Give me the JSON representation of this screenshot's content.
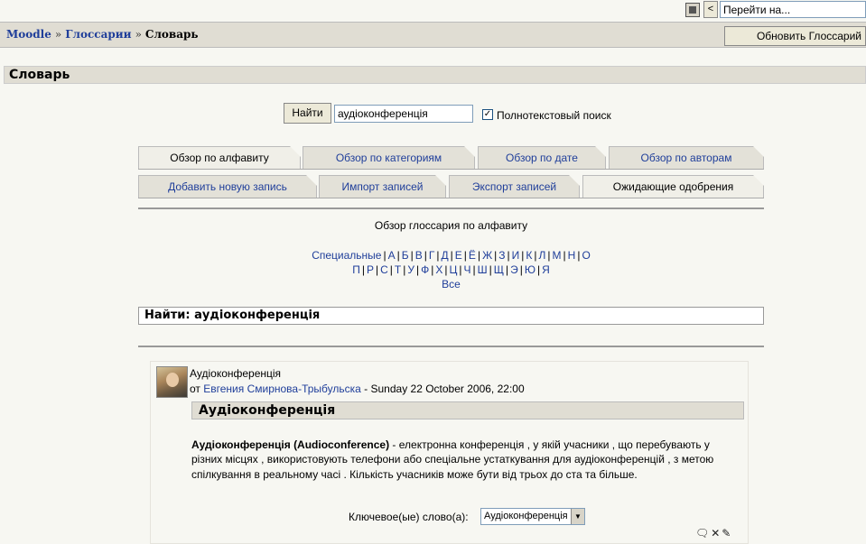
{
  "topbar": {
    "prev_label": "<",
    "jump_placeholder": "Перейти на..."
  },
  "navbar": {
    "breadcrumb": [
      "Moodle",
      "Глоссарии",
      "Словарь"
    ],
    "separator": "»",
    "update_button": "Обновить Глоссарий"
  },
  "heading": "Словарь",
  "search": {
    "button": "Найти",
    "value": "аудіоконференція",
    "fulltext_checked": true,
    "fulltext_label": "Полнотекстовый поиск"
  },
  "tabs_row1": [
    {
      "label": "Обзор по алфавиту",
      "active": true
    },
    {
      "label": "Обзор по категориям",
      "active": false
    },
    {
      "label": "Обзор по дате",
      "active": false
    },
    {
      "label": "Обзор по авторам",
      "active": false
    }
  ],
  "tabs_row2": [
    {
      "label": "Добавить новую запись",
      "active": false
    },
    {
      "label": "Импорт записей",
      "active": false
    },
    {
      "label": "Экспорт записей",
      "active": false
    },
    {
      "label": "Ожидающие одобрения",
      "active": true
    }
  ],
  "browse": {
    "title": "Обзор глоссария по алфавиту",
    "line1": [
      "Специальные",
      "А",
      "Б",
      "В",
      "Г",
      "Д",
      "Е",
      "Ё",
      "Ж",
      "З",
      "И",
      "К",
      "Л",
      "М",
      "Н",
      "О"
    ],
    "line2": [
      "П",
      "Р",
      "С",
      "Т",
      "У",
      "Ф",
      "Х",
      "Ц",
      "Ч",
      "Ш",
      "Щ",
      "Э",
      "Ю",
      "Я"
    ],
    "all": "Все"
  },
  "find_result": "Найти: аудіоконференція",
  "entry": {
    "concept_small": "Аудіоконференція",
    "author_prefix": "от",
    "author": "Евгения Смирнова-Трыбульска",
    "date": "- Sunday 22 October 2006, 22:00",
    "concept_header": "Аудіоконференція",
    "definition_bold": "Аудіоконференція (Audioconference)",
    "definition_rest": " - електронна конференція , у якій учасники , що перебувають у різних місцях , використовують телефони або спеціальне устаткування для аудіоконференцій , з метою спілкування в реальному часі . Кількість учасників може бути від трьох до ста та більше.",
    "keyword_label": "Ключевое(ые) слово(а):",
    "keyword_value": "Аудіоконференція",
    "keyword_arrow": "▼",
    "action_icons": "🗨✕✎"
  }
}
